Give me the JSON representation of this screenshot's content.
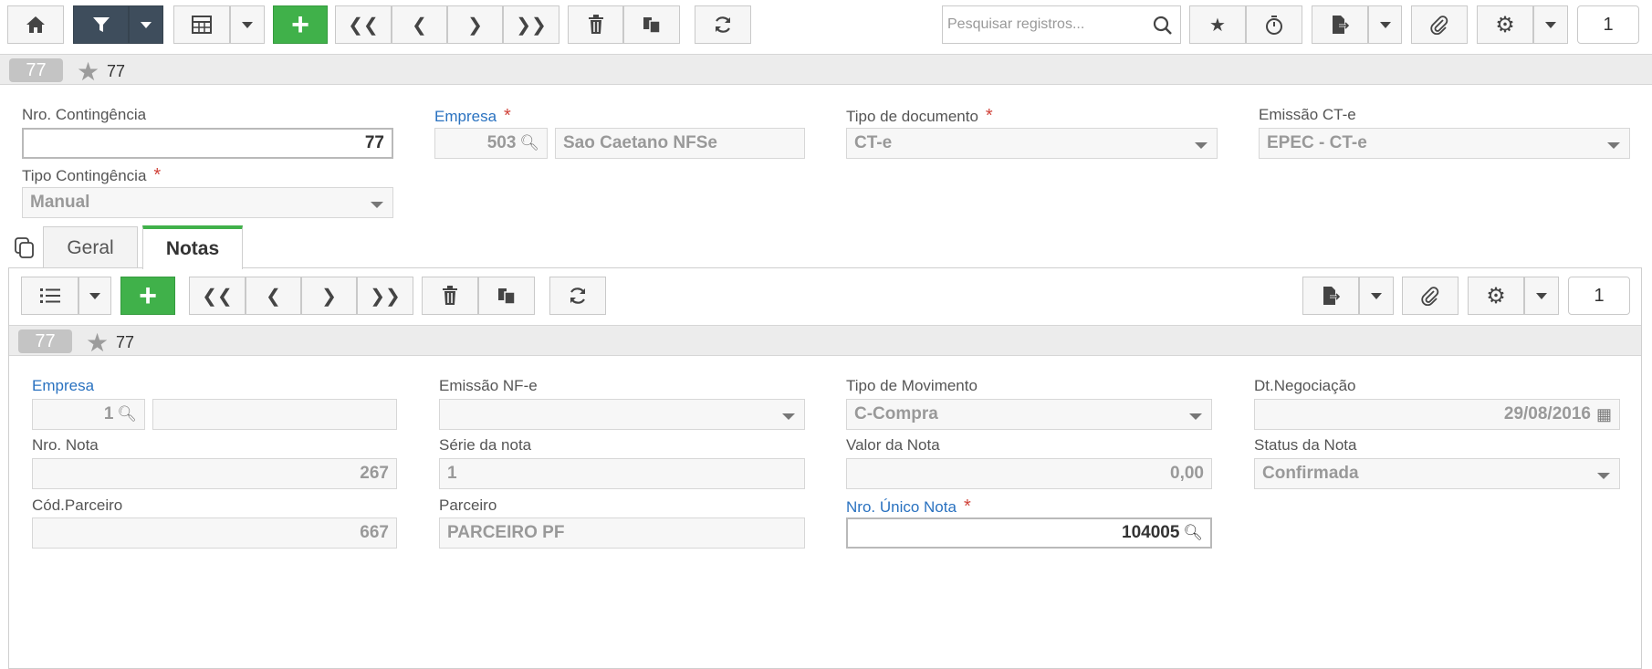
{
  "toolbar": {
    "search_placeholder": "Pesquisar registros...",
    "page_number": "1"
  },
  "record": {
    "badge": "77",
    "title": "77"
  },
  "form": {
    "nro_contingencia": {
      "label": "Nro. Contingência",
      "value": "77"
    },
    "empresa": {
      "label": "Empresa",
      "required": "*",
      "code": "503",
      "name": "Sao Caetano NFSe"
    },
    "tipo_documento": {
      "label": "Tipo de documento",
      "required": "*",
      "value": "CT-e"
    },
    "emissao_cte": {
      "label": "Emissão CT-e",
      "value": "EPEC - CT-e"
    },
    "tipo_contingencia": {
      "label": "Tipo Contingência",
      "required": "*",
      "value": "Manual"
    }
  },
  "tabs": [
    {
      "label": "Geral"
    },
    {
      "label": "Notas"
    }
  ],
  "sub_toolbar": {
    "page_number": "1"
  },
  "sub_record": {
    "badge": "77",
    "title": "77"
  },
  "notas": {
    "empresa": {
      "label": "Empresa",
      "code": "1",
      "name": ""
    },
    "emissao_nfe": {
      "label": "Emissão NF-e",
      "value": ""
    },
    "tipo_movimento": {
      "label": "Tipo de Movimento",
      "value": "C-Compra"
    },
    "dt_negociacao": {
      "label": "Dt.Negociação",
      "value": "29/08/2016"
    },
    "nro_nota": {
      "label": "Nro. Nota",
      "value": "267"
    },
    "serie_nota": {
      "label": "Série da nota",
      "value": "1"
    },
    "valor_nota": {
      "label": "Valor da Nota",
      "value": "0,00"
    },
    "status_nota": {
      "label": "Status da Nota",
      "value": "Confirmada"
    },
    "cod_parceiro": {
      "label": "Cód.Parceiro",
      "value": "667"
    },
    "parceiro": {
      "label": "Parceiro",
      "value": "PARCEIRO PF"
    },
    "nro_unico_nota": {
      "label": "Nro. Único Nota",
      "required": "*",
      "value": "104005"
    }
  }
}
